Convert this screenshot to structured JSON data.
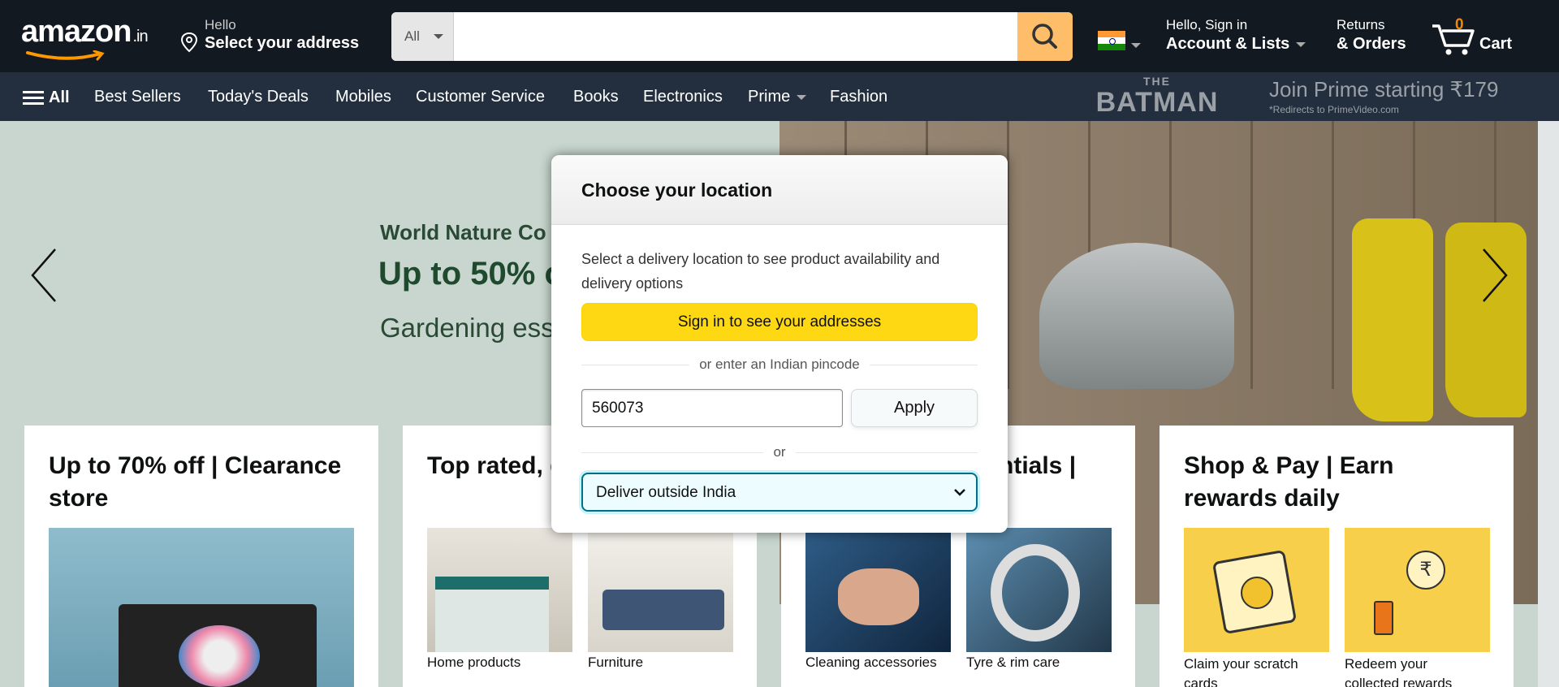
{
  "header": {
    "logo": "amazon",
    "logo_tld": ".in",
    "address_line1": "Hello",
    "address_line2": "Select your address",
    "search_category": "All",
    "search_placeholder": "",
    "account_line1": "Hello, Sign in",
    "account_line2": "Account & Lists",
    "orders_line1": "Returns",
    "orders_line2": "& Orders",
    "cart_count": "0",
    "cart_label": "Cart"
  },
  "subnav": {
    "all_label": "All",
    "items": [
      "Best Sellers",
      "Today's Deals",
      "Mobiles",
      "Customer Service",
      "Books",
      "Electronics",
      "Prime",
      "Fashion"
    ],
    "promo_logo_small": "THE",
    "promo_logo_big": "BATMAN",
    "promo_text": "Join Prime starting ₹179",
    "promo_note": "*Redirects to PrimeVideo.com"
  },
  "hero": {
    "line1": "World Nature Co",
    "line2": "Up to 50% o",
    "line3": "Gardening ess"
  },
  "cards": [
    {
      "title": "Up to 70% off | Clearance store",
      "captions": []
    },
    {
      "title": "Top rated, quality | A",
      "captions": [
        "Home products",
        "Furniture"
      ]
    },
    {
      "title": "ntials |",
      "captions": [
        "Cleaning accessories",
        "Tyre & rim care"
      ]
    },
    {
      "title": "Shop & Pay | Earn rewards daily",
      "captions": [
        "Claim your scratch cards",
        "Redeem your collected rewards"
      ]
    }
  ],
  "modal": {
    "title": "Choose your location",
    "description": "Select a delivery location to see product availability and delivery options",
    "signin_button": "Sign in to see your addresses",
    "divider1": "or enter an Indian pincode",
    "pincode_value": "560073",
    "apply_button": "Apply",
    "divider2": "or",
    "outside_select": "Deliver outside India"
  },
  "colors": {
    "nav_dark": "#131921",
    "nav_secondary": "#232f3e",
    "search_button": "#febd69",
    "cart_count": "#f08804",
    "signin_button": "#ffd814",
    "select_focus": "#007185"
  }
}
